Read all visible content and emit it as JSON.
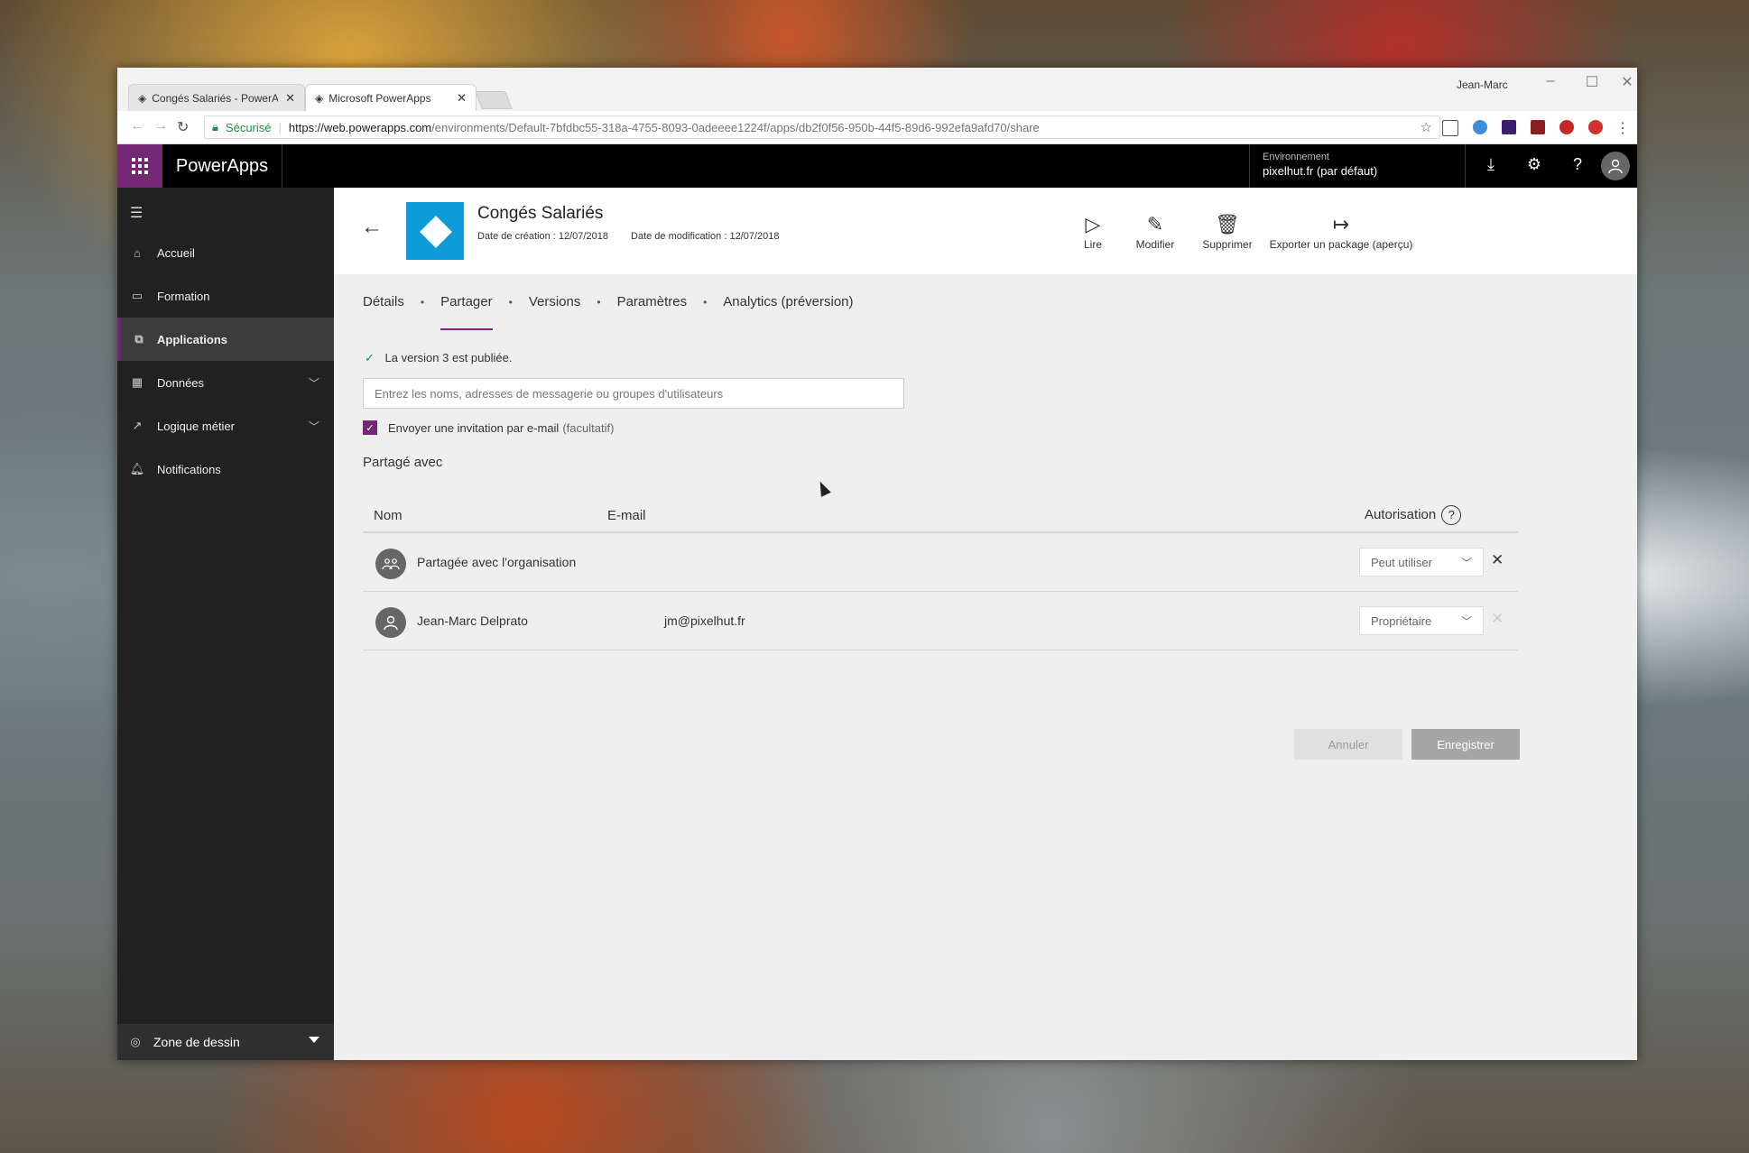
{
  "browser": {
    "tabs": [
      {
        "label": "Congés Salariés - PowerA",
        "active": false
      },
      {
        "label": "Microsoft PowerApps",
        "active": true
      }
    ],
    "user": "Jean-Marc",
    "secure_label": "Sécurisé",
    "url_host": "https://web.powerapps.com",
    "url_path": "/environments/Default-7bfdbc55-318a-4755-8093-0adeeee1224f/apps/db2f0f56-950b-44f5-89d6-992efa9afd70/share"
  },
  "header": {
    "brand": "PowerApps",
    "env_label": "Environnement",
    "env_value": "pixelhut.fr (par défaut)",
    "accent_color": "#742774"
  },
  "sidebar": {
    "items": [
      {
        "label": "Accueil",
        "icon": "home-icon"
      },
      {
        "label": "Formation",
        "icon": "book-icon"
      },
      {
        "label": "Applications",
        "icon": "apps-icon",
        "active": true
      },
      {
        "label": "Données",
        "icon": "table-icon",
        "expandable": true
      },
      {
        "label": "Logique métier",
        "icon": "flow-icon",
        "expandable": true
      },
      {
        "label": "Notifications",
        "icon": "bell-icon"
      }
    ],
    "zone_label": "Zone de dessin"
  },
  "app": {
    "title": "Congés Salariés",
    "created": "Date de création : 12/07/2018",
    "modified": "Date de modification : 12/07/2018",
    "icon_color": "#0f9bd7",
    "actions": {
      "play": "Lire",
      "edit": "Modifier",
      "delete": "Supprimer",
      "export": "Exporter un package (aperçu)"
    }
  },
  "tabs": [
    "Détails",
    "Partager",
    "Versions",
    "Paramètres",
    "Analytics (préversion)"
  ],
  "active_tab": "Partager",
  "share": {
    "published": "La version 3 est publiée.",
    "input_placeholder": "Entrez les noms, adresses de messagerie ou groupes d'utilisateurs",
    "invite_label": "Envoyer une invitation par e-mail",
    "invite_optional": "(facultatif)",
    "invite_checked": true,
    "shared_with_title": "Partagé avec",
    "columns": {
      "name": "Nom",
      "email": "E-mail",
      "permission": "Autorisation"
    },
    "rows": [
      {
        "name": "Partagée avec l'organisation",
        "email": "",
        "permission": "Peut utiliser",
        "removable": true
      },
      {
        "name": "Jean-Marc Delprato",
        "email": "jm@pixelhut.fr",
        "permission": "Propriétaire",
        "removable": false
      }
    ],
    "cancel_label": "Annuler",
    "save_label": "Enregistrer"
  }
}
